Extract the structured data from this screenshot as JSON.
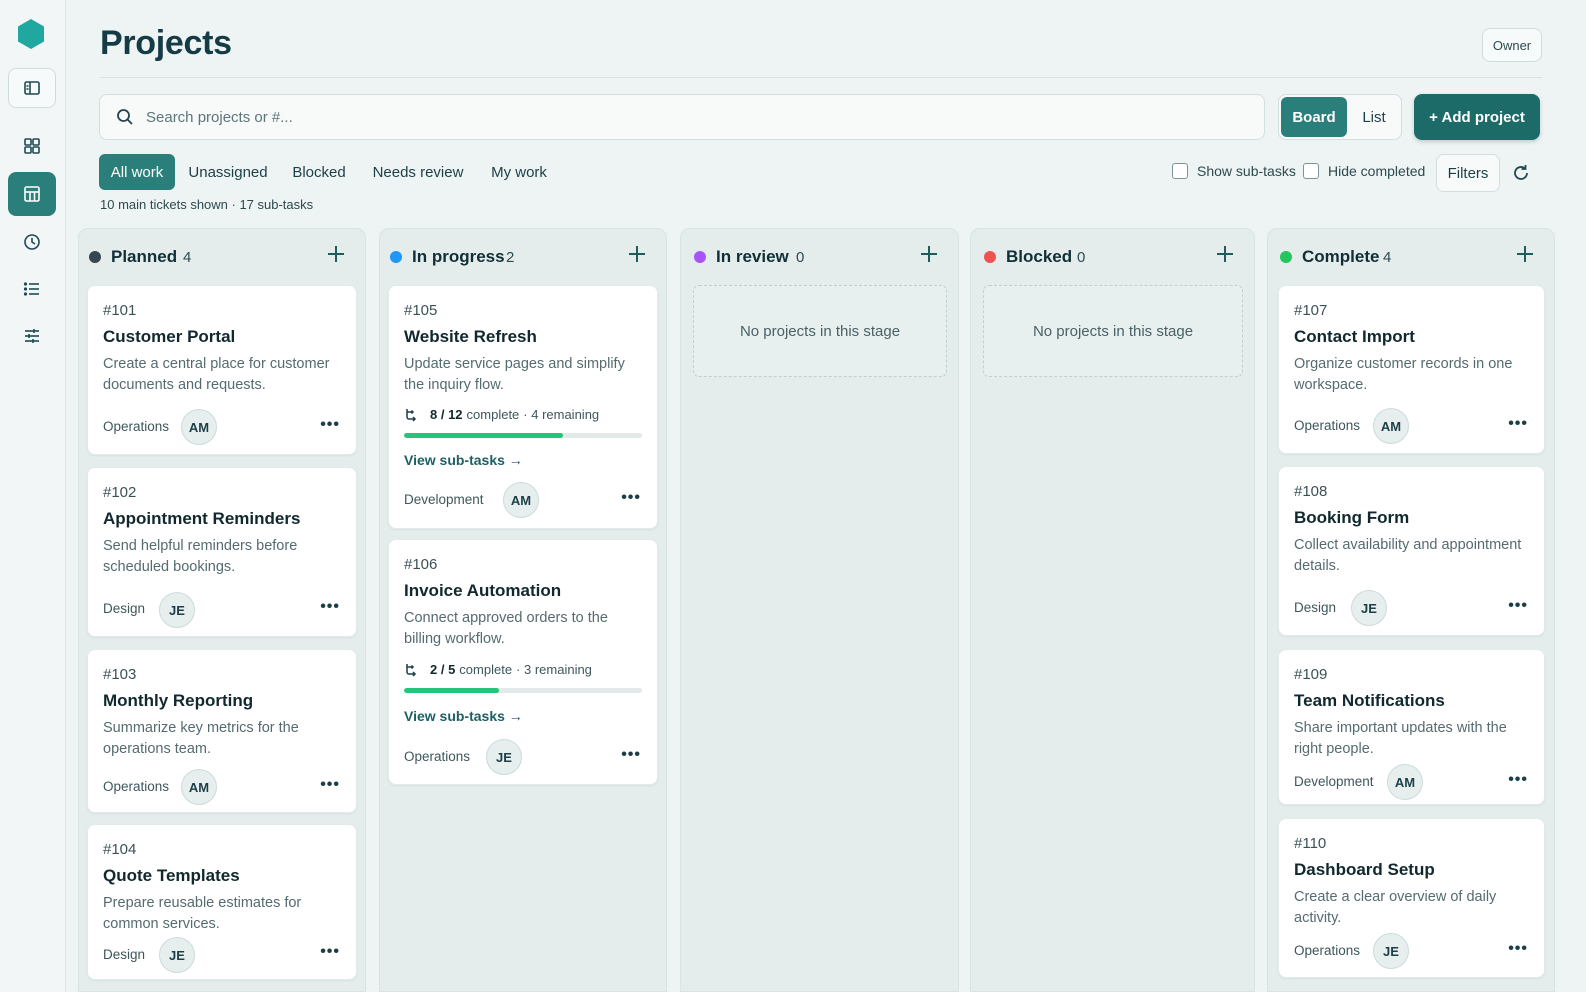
{
  "page": {
    "title": "Projects",
    "owner_label": "Owner"
  },
  "search": {
    "placeholder": "Search projects or #..."
  },
  "view": {
    "board": "Board",
    "list": "List",
    "active": "Board"
  },
  "add_project": "+ Add project",
  "tabs": [
    {
      "label": "All work",
      "active": true
    },
    {
      "label": "Unassigned",
      "active": false
    },
    {
      "label": "Blocked",
      "active": false
    },
    {
      "label": "Needs review",
      "active": false
    },
    {
      "label": "My work",
      "active": false
    }
  ],
  "summary": "10 main tickets shown · 17 sub-tasks",
  "options": {
    "show_subtasks": {
      "label": "Show sub-tasks",
      "checked": false
    },
    "hide_completed": {
      "label": "Hide completed",
      "checked": false
    },
    "filters": "Filters"
  },
  "colors": {
    "accent": "#2b7f7b",
    "planned": "#37474f",
    "in_progress": "#2196f3",
    "in_review": "#a855f7",
    "blocked": "#ef5350",
    "complete": "#22c55e",
    "progress": "#22c57a"
  },
  "columns": [
    {
      "title": "Planned",
      "count": "4",
      "dot_color": "#37474f",
      "cards": [
        {
          "id": "#101",
          "title": "Customer Portal",
          "desc": "Create a central place for customer documents and requests.",
          "team": "Operations",
          "assignee": "AM"
        },
        {
          "id": "#102",
          "title": "Appointment Reminders",
          "desc": "Send helpful reminders before scheduled bookings.",
          "team": "Design",
          "assignee": "JE"
        },
        {
          "id": "#103",
          "title": "Monthly Reporting",
          "desc": "Summarize key metrics for the operations team.",
          "team": "Operations",
          "assignee": "AM"
        },
        {
          "id": "#104",
          "title": "Quote Templates",
          "desc": "Prepare reusable estimates for common services.",
          "team": "Design",
          "assignee": "JE"
        }
      ]
    },
    {
      "title": "In progress",
      "count": "2",
      "dot_color": "#2196f3",
      "cards": [
        {
          "id": "#105",
          "title": "Website Refresh",
          "desc": "Update service pages and simplify the inquiry flow.",
          "subtasks": "8 / 12",
          "complete_word": "complete",
          "remaining": "· 4 remaining",
          "progress": 0.667,
          "link": "View sub-tasks →",
          "team": "Development",
          "assignee": "AM"
        },
        {
          "id": "#106",
          "title": "Invoice Automation",
          "desc": "Connect approved orders to the billing workflow.",
          "subtasks": "2 / 5",
          "complete_word": "complete",
          "remaining": "· 3 remaining",
          "progress": 0.4,
          "link": "View sub-tasks →",
          "team": "Operations",
          "assignee": "JE"
        }
      ]
    },
    {
      "title": "In review",
      "count": "0",
      "dot_color": "#a855f7",
      "empty": "No projects in this stage"
    },
    {
      "title": "Blocked",
      "count": "0",
      "dot_color": "#ef5350",
      "empty": "No projects in this stage"
    },
    {
      "title": "Complete",
      "count": "4",
      "dot_color": "#22c55e",
      "cards": [
        {
          "id": "#107",
          "title": "Contact Import",
          "desc": "Organize customer records in one workspace.",
          "team": "Operations",
          "assignee": "AM"
        },
        {
          "id": "#108",
          "title": "Booking Form",
          "desc": "Collect availability and appointment details.",
          "team": "Design",
          "assignee": "JE"
        },
        {
          "id": "#109",
          "title": "Team Notifications",
          "desc": "Share important updates with the right people.",
          "team": "Development",
          "assignee": "AM"
        },
        {
          "id": "#110",
          "title": "Dashboard Setup",
          "desc": "Create a clear overview of daily activity.",
          "team": "Operations",
          "assignee": "JE"
        }
      ]
    }
  ]
}
